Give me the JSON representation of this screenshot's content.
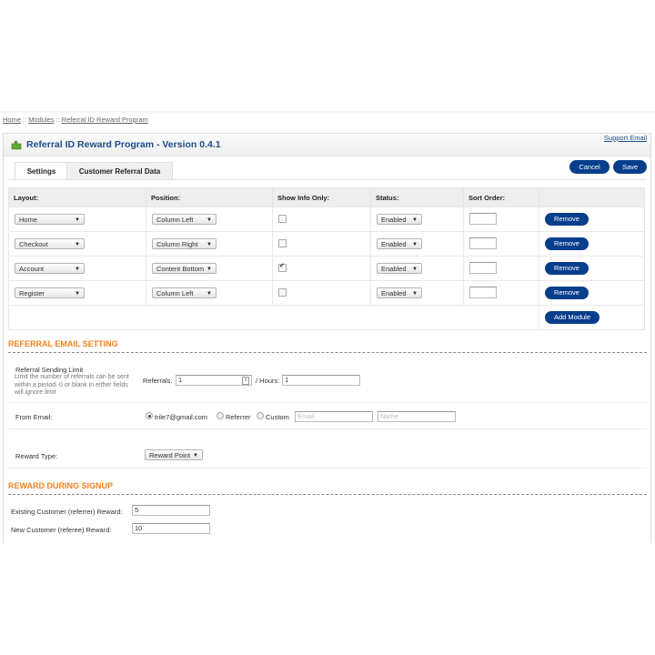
{
  "breadcrumb": [
    {
      "label": "Home"
    },
    {
      "label": "Modules"
    },
    {
      "label": "Referral ID Reward Program"
    }
  ],
  "breadcrumb_separator": "::",
  "header": {
    "title": "Referral ID Reward Program - Version 0.4.1",
    "support_link": "Support Email",
    "icon": "puzzle-piece-icon"
  },
  "tabs": [
    {
      "label": "Settings",
      "active": true
    },
    {
      "label": "Customer Referral Data",
      "active": false
    }
  ],
  "toolbar": {
    "cancel_label": "Cancel",
    "save_label": "Save"
  },
  "modules_table": {
    "columns": [
      "Layout:",
      "Position:",
      "Show Info Only:",
      "Status:",
      "Sort Order:",
      ""
    ],
    "rows": [
      {
        "layout": "Home",
        "position": "Column Left",
        "show_info_only": false,
        "status": "Enabled",
        "sort_order": "",
        "action": "Remove"
      },
      {
        "layout": "Checkout",
        "position": "Column Right",
        "show_info_only": false,
        "status": "Enabled",
        "sort_order": "",
        "action": "Remove"
      },
      {
        "layout": "Account",
        "position": "Content Bottom",
        "show_info_only": true,
        "status": "Enabled",
        "sort_order": "",
        "action": "Remove"
      },
      {
        "layout": "Register",
        "position": "Column Left",
        "show_info_only": false,
        "status": "Enabled",
        "sort_order": "",
        "action": "Remove"
      }
    ],
    "add_label": "Add Module"
  },
  "referral_email": {
    "section_title": "REFERRAL EMAIL SETTING",
    "sending_limit_label": "Referral Sending Limit",
    "sending_limit_help": "Limit the number of referrals can be sent within a period. 0 or blank in either fields will ignore limit",
    "referrals_label": "Referrals:",
    "referrals_value": "1",
    "hours_label": "/ Hours:",
    "hours_value": "1",
    "from_email_label": "From Email:",
    "from_options": [
      {
        "label": "trile7@gmail.com",
        "selected": true
      },
      {
        "label": "Referrer",
        "selected": false
      },
      {
        "label": "Custom",
        "selected": false
      }
    ],
    "custom_email_placeholder": "Email",
    "custom_name_placeholder": "Name",
    "reward_type_label": "Reward Type:",
    "reward_type_value": "Reward Point"
  },
  "reward_signup": {
    "section_title": "REWARD DURING SIGNUP",
    "existing_label": "Existing Customer (referrer) Reward:",
    "existing_value": "5",
    "new_label": "New Customer (referee) Reward:",
    "new_value": "10"
  },
  "colors": {
    "accent_blue": "#073e8c",
    "title_blue": "#1e4d8b",
    "section_orange": "#f58220"
  }
}
